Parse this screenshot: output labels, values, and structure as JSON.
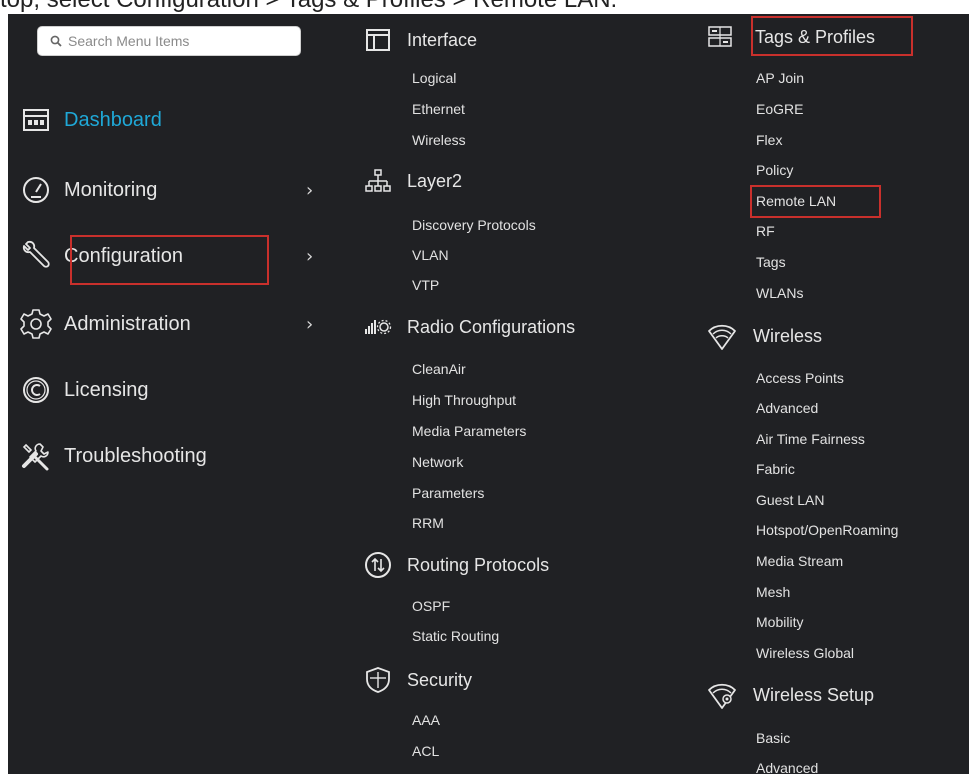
{
  "header_fragment": "top, select Configuration > Tags & Profiles > Remote LAN.",
  "search": {
    "placeholder": "Search Menu Items"
  },
  "nav": [
    {
      "label": "Dashboard",
      "icon": "dashboard-icon",
      "active": true
    },
    {
      "label": "Monitoring",
      "icon": "gauge-icon",
      "chevron": "›"
    },
    {
      "label": "Configuration",
      "icon": "wrench-icon",
      "chevron": "›"
    },
    {
      "label": "Administration",
      "icon": "gear-icon",
      "chevron": "›"
    },
    {
      "label": "Licensing",
      "icon": "license-icon"
    },
    {
      "label": "Troubleshooting",
      "icon": "tools-icon"
    }
  ],
  "columns": {
    "col1": [
      {
        "title": "Interface",
        "icon": "interface-icon",
        "items": [
          "Logical",
          "Ethernet",
          "Wireless"
        ]
      },
      {
        "title": "Layer2",
        "icon": "layer2-icon",
        "items": [
          "Discovery Protocols",
          "VLAN",
          "VTP"
        ]
      },
      {
        "title": "Radio Configurations",
        "icon": "radio-icon",
        "items": [
          "CleanAir",
          "High Throughput",
          "Media Parameters",
          "Network",
          "Parameters",
          "RRM"
        ]
      },
      {
        "title": "Routing Protocols",
        "icon": "routing-icon",
        "items": [
          "OSPF",
          "Static Routing"
        ]
      },
      {
        "title": "Security",
        "icon": "shield-icon",
        "items": [
          "AAA",
          "ACL"
        ]
      }
    ],
    "col2": [
      {
        "title": "Tags & Profiles",
        "icon": "tags-icon",
        "items": [
          "AP Join",
          "EoGRE",
          "Flex",
          "Policy",
          "Remote LAN",
          "RF",
          "Tags",
          "WLANs"
        ]
      },
      {
        "title": "Wireless",
        "icon": "wifi-icon",
        "items": [
          "Access Points",
          "Advanced",
          "Air Time Fairness",
          "Fabric",
          "Guest LAN",
          "Hotspot/OpenRoaming",
          "Media Stream",
          "Mesh",
          "Mobility",
          "Wireless Global"
        ]
      },
      {
        "title": "Wireless Setup",
        "icon": "wifi-gear-icon",
        "items": [
          "Basic",
          "Advanced"
        ]
      }
    ]
  },
  "colors": {
    "background": "#202124",
    "text": "#e6e6e6",
    "accent": "#1fa8d7",
    "highlight": "#c9302c"
  }
}
